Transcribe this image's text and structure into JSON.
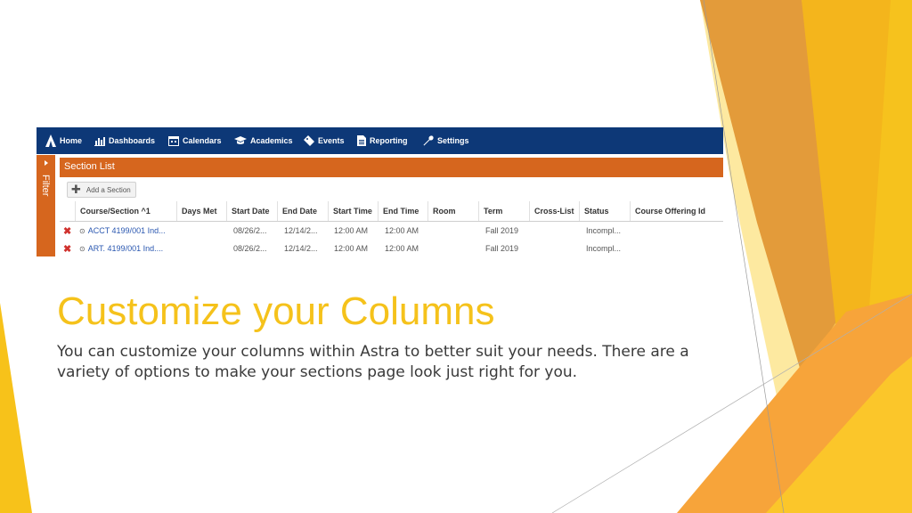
{
  "slide": {
    "title": "Customize your Columns",
    "body": "You can customize your columns within Astra to better suit your needs. There are a variety of options to make your sections page look just right for you."
  },
  "nav": {
    "items": [
      {
        "label": "Home",
        "icon": "astra-logo-icon"
      },
      {
        "label": "Dashboards",
        "icon": "bar-chart-icon"
      },
      {
        "label": "Calendars",
        "icon": "calendar-icon"
      },
      {
        "label": "Academics",
        "icon": "graduation-cap-icon"
      },
      {
        "label": "Events",
        "icon": "ticket-icon"
      },
      {
        "label": "Reporting",
        "icon": "document-icon"
      },
      {
        "label": "Settings",
        "icon": "wrench-icon"
      }
    ]
  },
  "filter": {
    "label": "Filter"
  },
  "section_list": {
    "title": "Section List",
    "add_button": "Add a Section",
    "columns": [
      "Course/Section ^1",
      "Days Met",
      "Start Date",
      "End Date",
      "Start Time",
      "End Time",
      "Room",
      "Term",
      "Cross-List",
      "Status",
      "Course Offering Id"
    ],
    "rows": [
      {
        "course": "ACCT 4199/001 Ind...",
        "days_met": "",
        "start_date": "08/26/2...",
        "end_date": "12/14/2...",
        "start_time": "12:00 AM",
        "end_time": "12:00 AM",
        "room": "",
        "term": "Fall 2019",
        "cross_list": "",
        "status": "Incompl...",
        "offering_id": ""
      },
      {
        "course": "ART. 4199/001 Ind....",
        "days_met": "",
        "start_date": "08/26/2...",
        "end_date": "12/14/2...",
        "start_time": "12:00 AM",
        "end_time": "12:00 AM",
        "room": "",
        "term": "Fall 2019",
        "cross_list": "",
        "status": "Incompl...",
        "offering_id": ""
      }
    ]
  },
  "colors": {
    "nav_bg": "#0d3877",
    "accent_orange": "#d6661e",
    "title_yellow": "#f5c21b",
    "link_blue": "#2a57b0",
    "delete_red": "#d0312d"
  }
}
